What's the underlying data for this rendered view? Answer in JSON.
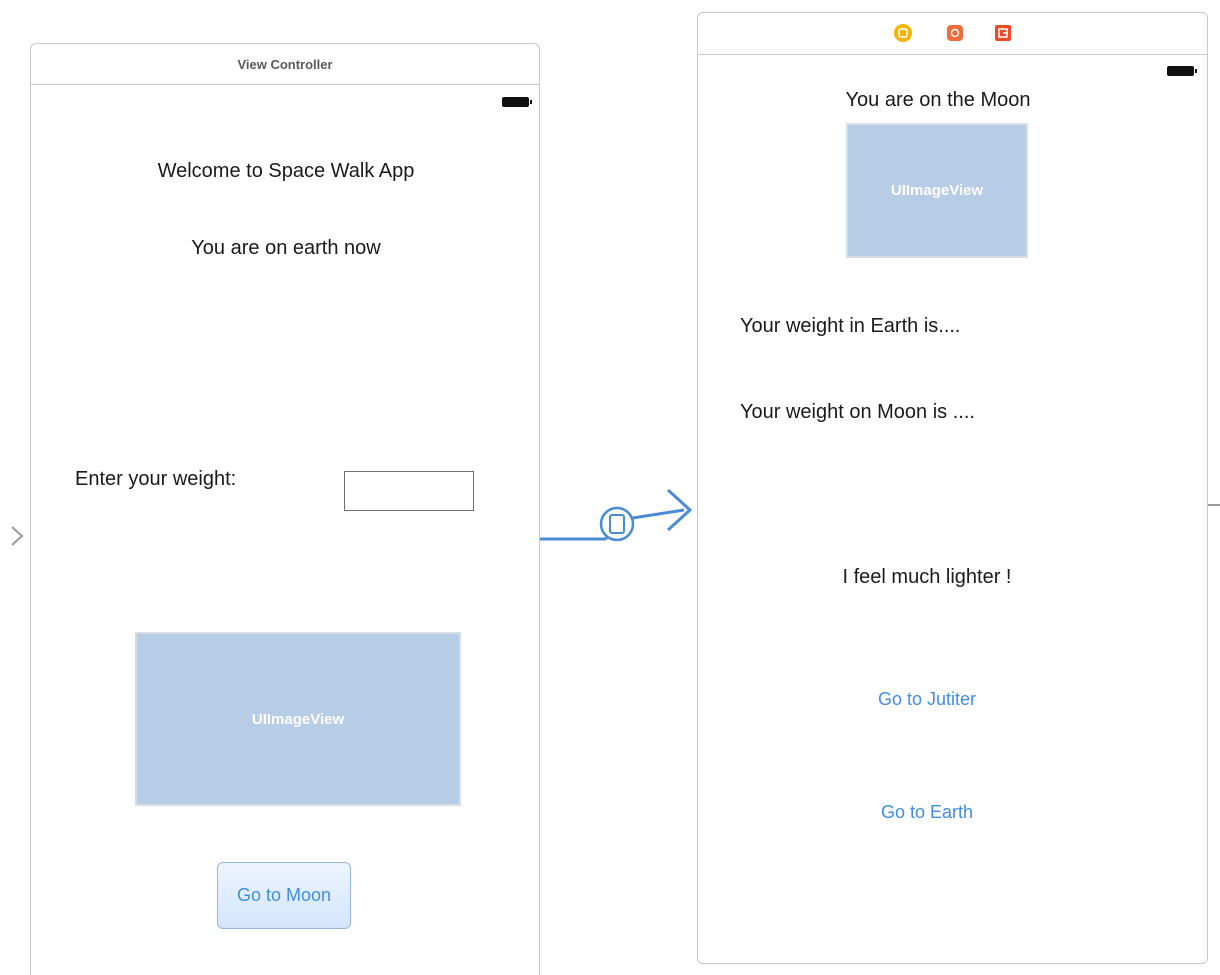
{
  "left_scene": {
    "title": "View Controller",
    "welcome_label": "Welcome to Space Walk App",
    "earth_label": "You are on earth now",
    "weight_prompt": "Enter your weight:",
    "weight_field_value": "",
    "image_view_label": "UIImageView",
    "go_to_moon_button": "Go to Moon"
  },
  "right_scene": {
    "dock_icons": [
      {
        "name": "view-controller-icon",
        "color": "#f5b400"
      },
      {
        "name": "first-responder-icon",
        "color": "#f06a3a"
      },
      {
        "name": "exit-icon",
        "color": "#f04a2a"
      }
    ],
    "moon_label": "You are on the Moon",
    "image_view_label": "UIImageView",
    "earth_weight_label": "Your weight in Earth is....",
    "moon_weight_label": "Your weight on Moon is ....",
    "lighter_label": "I feel much lighter !",
    "go_to_jupiter_button": "Go to Jutiter",
    "go_to_earth_button": "Go to Earth"
  },
  "colors": {
    "segue": "#4a8bd6",
    "button_text": "#3f8ee0",
    "image_view_fill": "#b7cce5"
  }
}
